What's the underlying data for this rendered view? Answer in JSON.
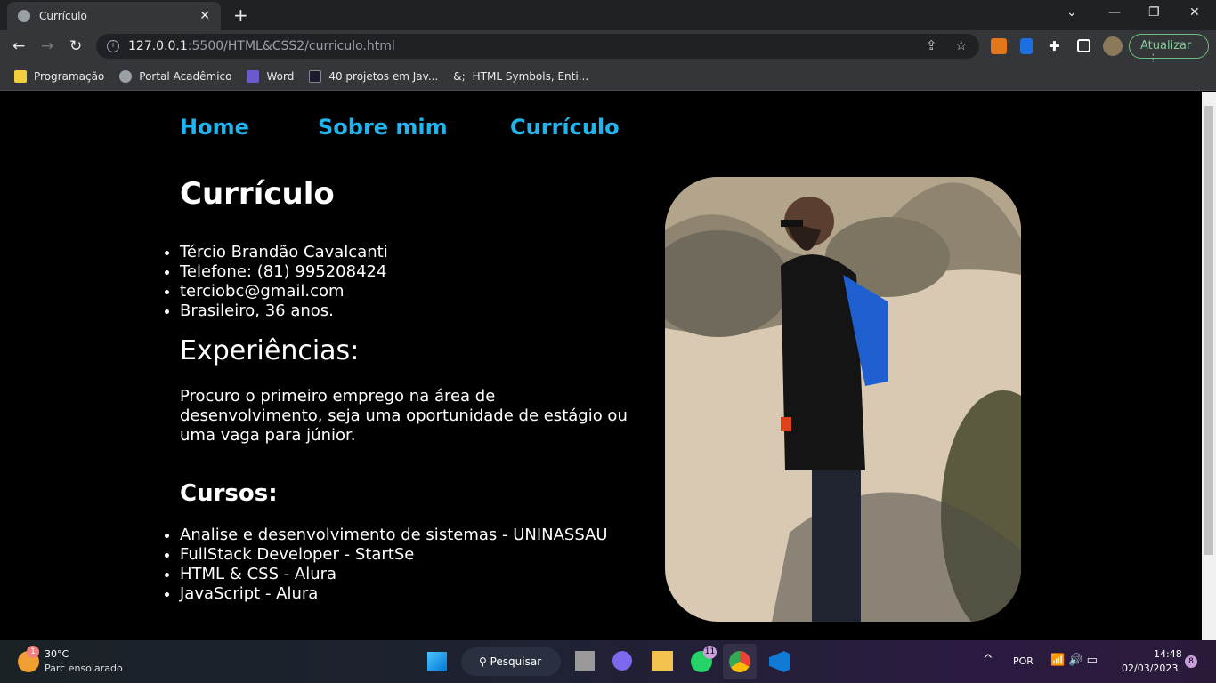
{
  "browser": {
    "tab_title": "Currículo",
    "url_host": "127.0.0.1",
    "url_path": ":5500/HTML&CSS2/curriculo.html",
    "update_label": "Atualizar",
    "bookmarks": [
      {
        "label": "Programação",
        "icon": "folder-icon",
        "color": "#f4d03f"
      },
      {
        "label": "Portal Acadêmico",
        "icon": "globe-icon",
        "color": "#9aa0a6"
      },
      {
        "label": "Word",
        "icon": "word-icon",
        "color": "#6a5acd"
      },
      {
        "label": "40 projetos em Jav...",
        "icon": "site-icon",
        "color": "#1a1a2e"
      },
      {
        "label": "HTML Symbols, Enti...",
        "icon": "ampersand-icon",
        "color": "#35363a"
      }
    ]
  },
  "nav": {
    "items": [
      "Home",
      "Sobre mim",
      "Currículo"
    ],
    "color": "#1fb6f0"
  },
  "main": {
    "title": "Currículo",
    "info": [
      "Tércio Brandão Cavalcanti",
      "Telefone: (81) 995208424",
      "terciobc@gmail.com",
      "Brasileiro, 36 anos."
    ],
    "experiences_title": "Experiências:",
    "experiences_text": "Procuro o primeiro emprego na área de desenvolvimento, seja uma oportunidade de estágio ou uma vaga para júnior.",
    "courses_title": "Cursos:",
    "courses": [
      "Analise e desenvolvimento de sistemas - UNINASSAU",
      "FullStack Developer - StartSe",
      "HTML & CSS - Alura",
      "JavaScript - Alura"
    ]
  },
  "taskbar": {
    "weather_temp": "30°C",
    "weather_desc": "Parc ensolarado",
    "weather_badge": "1",
    "search_label": "Pesquisar",
    "whatsapp_badge": "11",
    "language": "POR",
    "time": "14:48",
    "date": "02/03/2023",
    "notification_count": "8"
  }
}
